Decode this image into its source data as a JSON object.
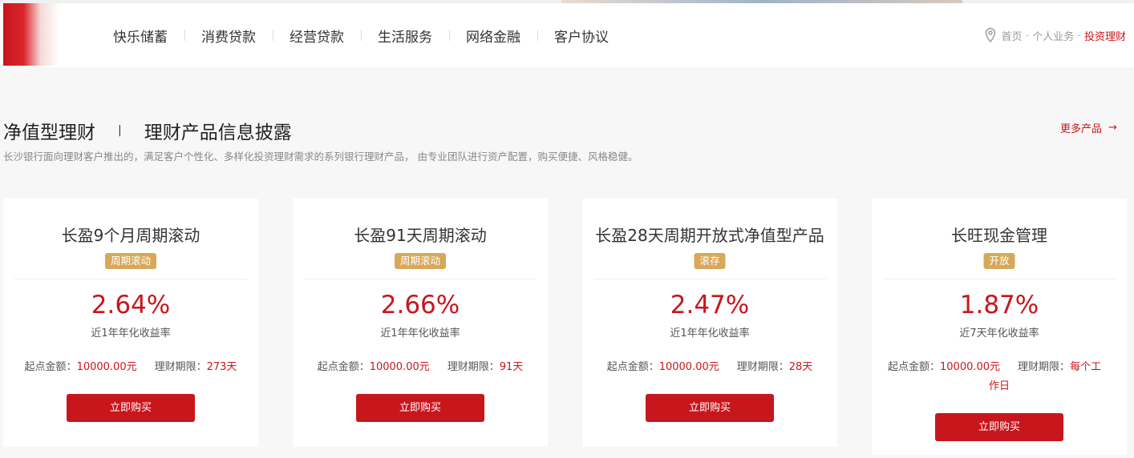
{
  "nav": {
    "items": [
      "快乐储蓄",
      "消费贷款",
      "经营贷款",
      "生活服务",
      "网络金融",
      "客户协议"
    ]
  },
  "breadcrumb": {
    "home": "首页",
    "level2": "个人业务",
    "current": "投资理财",
    "separator": "-"
  },
  "section": {
    "title1": "净值型理财",
    "divider": "|",
    "title2": "理财产品信息披露",
    "more": "更多产品",
    "more_arrow": "→",
    "description": "长沙银行面向理财客户推出的，满足客户个性化、多样化投资理财需求的系列银行理财产品， 由专业团队进行资产配置，购买便捷、风格稳健。"
  },
  "products": [
    {
      "name": "长盈9个月周期滚动",
      "badge": "周期滚动",
      "rate": "2.64%",
      "rate_label": "近1年年化收益率",
      "min_label": "起点金额：",
      "min_value": "10000.00元",
      "term_label": "理财期限：",
      "term_value": "273天",
      "buy_label": "立即购买"
    },
    {
      "name": "长盈91天周期滚动",
      "badge": "周期滚动",
      "rate": "2.66%",
      "rate_label": "近1年年化收益率",
      "min_label": "起点金额：",
      "min_value": "10000.00元",
      "term_label": "理财期限：",
      "term_value": "91天",
      "buy_label": "立即购买"
    },
    {
      "name": "长盈28天周期开放式净值型产品",
      "badge": "滚存",
      "rate": "2.47%",
      "rate_label": "近1年年化收益率",
      "min_label": "起点金额：",
      "min_value": "10000.00元",
      "term_label": "理财期限：",
      "term_value": "28天",
      "buy_label": "立即购买"
    },
    {
      "name": "长旺现金管理",
      "badge": "开放",
      "rate": "1.87%",
      "rate_label": "近7天年化收益率",
      "min_label": "起点金额：",
      "min_value": "10000.00元",
      "term_label": "理财期限：",
      "term_value_line1": "每个工",
      "term_value_line2": "作日",
      "buy_label": "立即购买"
    }
  ],
  "colors": {
    "brand_red": "#c8161d",
    "badge_gold": "#d8a85a"
  },
  "icons": {
    "location": "location-pin-icon",
    "arrow": "arrow-right-icon"
  }
}
